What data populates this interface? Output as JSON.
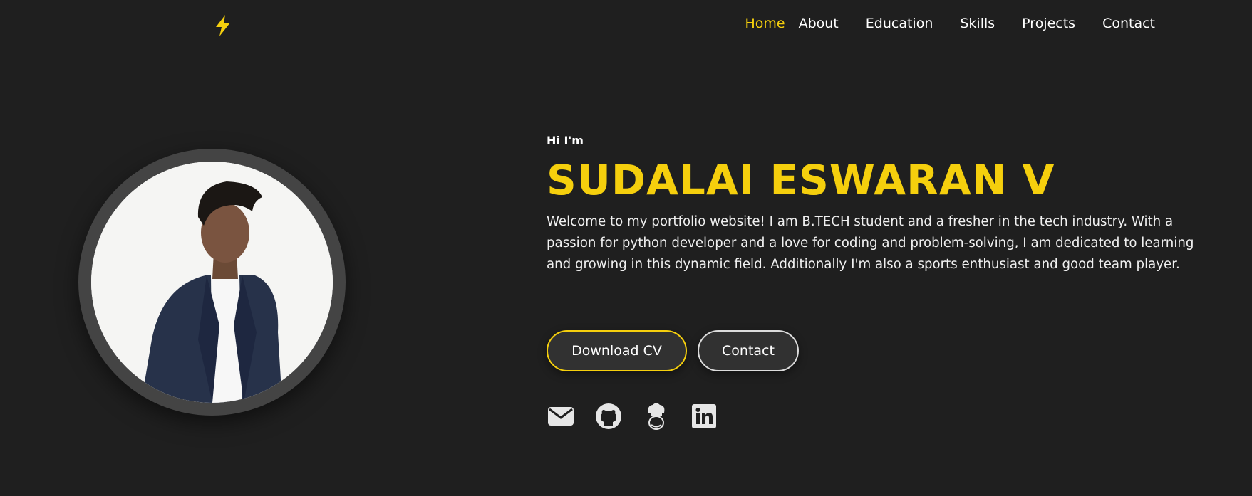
{
  "header": {
    "logo_icon": "lightning-bolt-icon",
    "nav": [
      {
        "label": "Home",
        "active": true
      },
      {
        "label": "About",
        "active": false
      },
      {
        "label": "Education",
        "active": false
      },
      {
        "label": "Skills",
        "active": false
      },
      {
        "label": "Projects",
        "active": false
      },
      {
        "label": "Contact",
        "active": false
      }
    ]
  },
  "hero": {
    "greeting": "Hi I'm",
    "name": "SUDALAI ESWARAN V",
    "bio": "Welcome to my portfolio website! I am B.TECH student and a fresher in the tech industry. With a passion for python developer and a love for coding and problem-solving, I am dedicated to learning and growing in this dynamic field. Additionally I'm also a sports enthusiast and good team player.",
    "buttons": {
      "download_cv": "Download CV",
      "contact": "Contact"
    },
    "socials": [
      "envelope-icon",
      "github-icon",
      "codechef-icon",
      "linkedin-icon"
    ]
  },
  "colors": {
    "background": "#1f1f1f",
    "accent": "#f5cf0d",
    "button_bg": "#313131",
    "avatar_ring": "#444444"
  }
}
